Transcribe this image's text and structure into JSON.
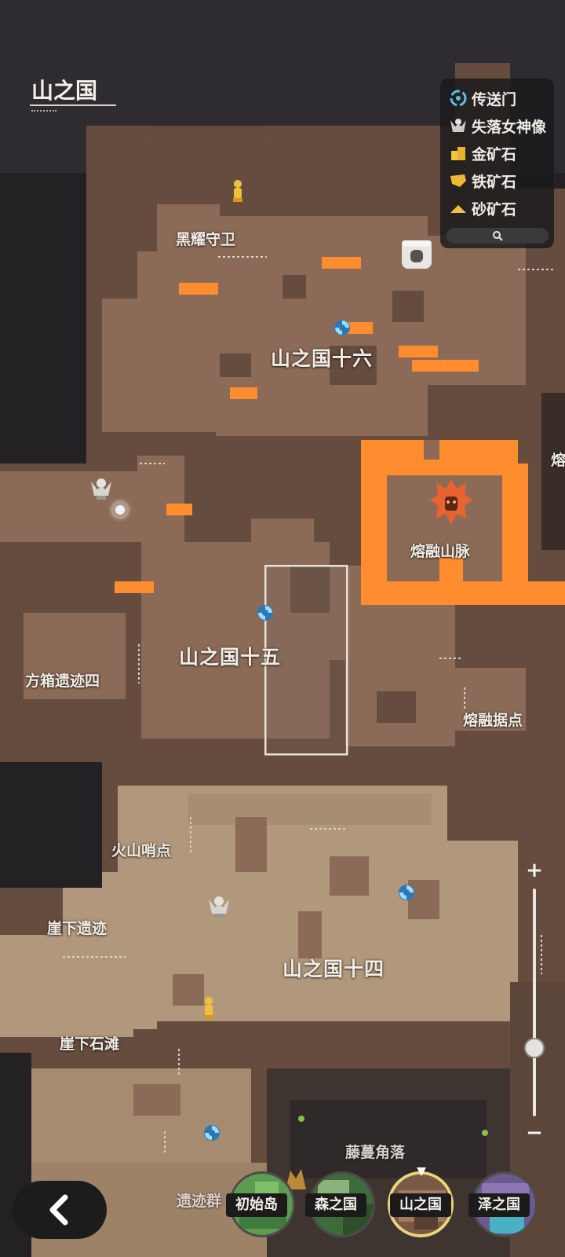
{
  "region_title": "山之国",
  "legend": {
    "items": [
      {
        "icon": "portal-icon",
        "label": "传送门"
      },
      {
        "icon": "goddess-statue-icon",
        "label": "失落女神像"
      },
      {
        "icon": "gold-ore-icon",
        "label": "金矿石"
      },
      {
        "icon": "iron-ore-icon",
        "label": "铁矿石"
      },
      {
        "icon": "sand-ore-icon",
        "label": "砂矿石"
      }
    ],
    "search_icon": "search-icon"
  },
  "map_labels": {
    "heiyao": "黑耀守卫",
    "mountain16": "山之国十六",
    "molten_range": "熔融山脉",
    "mountain15": "山之国十五",
    "fangxiang": "方箱遗迹四",
    "molten_base": "熔融据点",
    "volcano_post": "火山哨点",
    "cliff_ruins": "崖下遗迹",
    "mountain14": "山之国十四",
    "cliff_shoal": "崖下石滩",
    "ruins_group": "遗迹群",
    "vine_corner": "藤蔓角落",
    "edge_partial": "熔"
  },
  "zoom": {
    "plus": "+",
    "minus": "−",
    "level": 0.3
  },
  "regions": [
    {
      "label": "初始岛",
      "active": false
    },
    {
      "label": "森之国",
      "active": false
    },
    {
      "label": "山之国",
      "active": true
    },
    {
      "label": "泽之国",
      "active": false
    }
  ],
  "colors": {
    "dark_rock": "#664c3e",
    "light_rock": "#8b6b57",
    "pale_rock": "#b1977b",
    "lava": "#ff8c2e",
    "void": "#1f1d1f"
  }
}
